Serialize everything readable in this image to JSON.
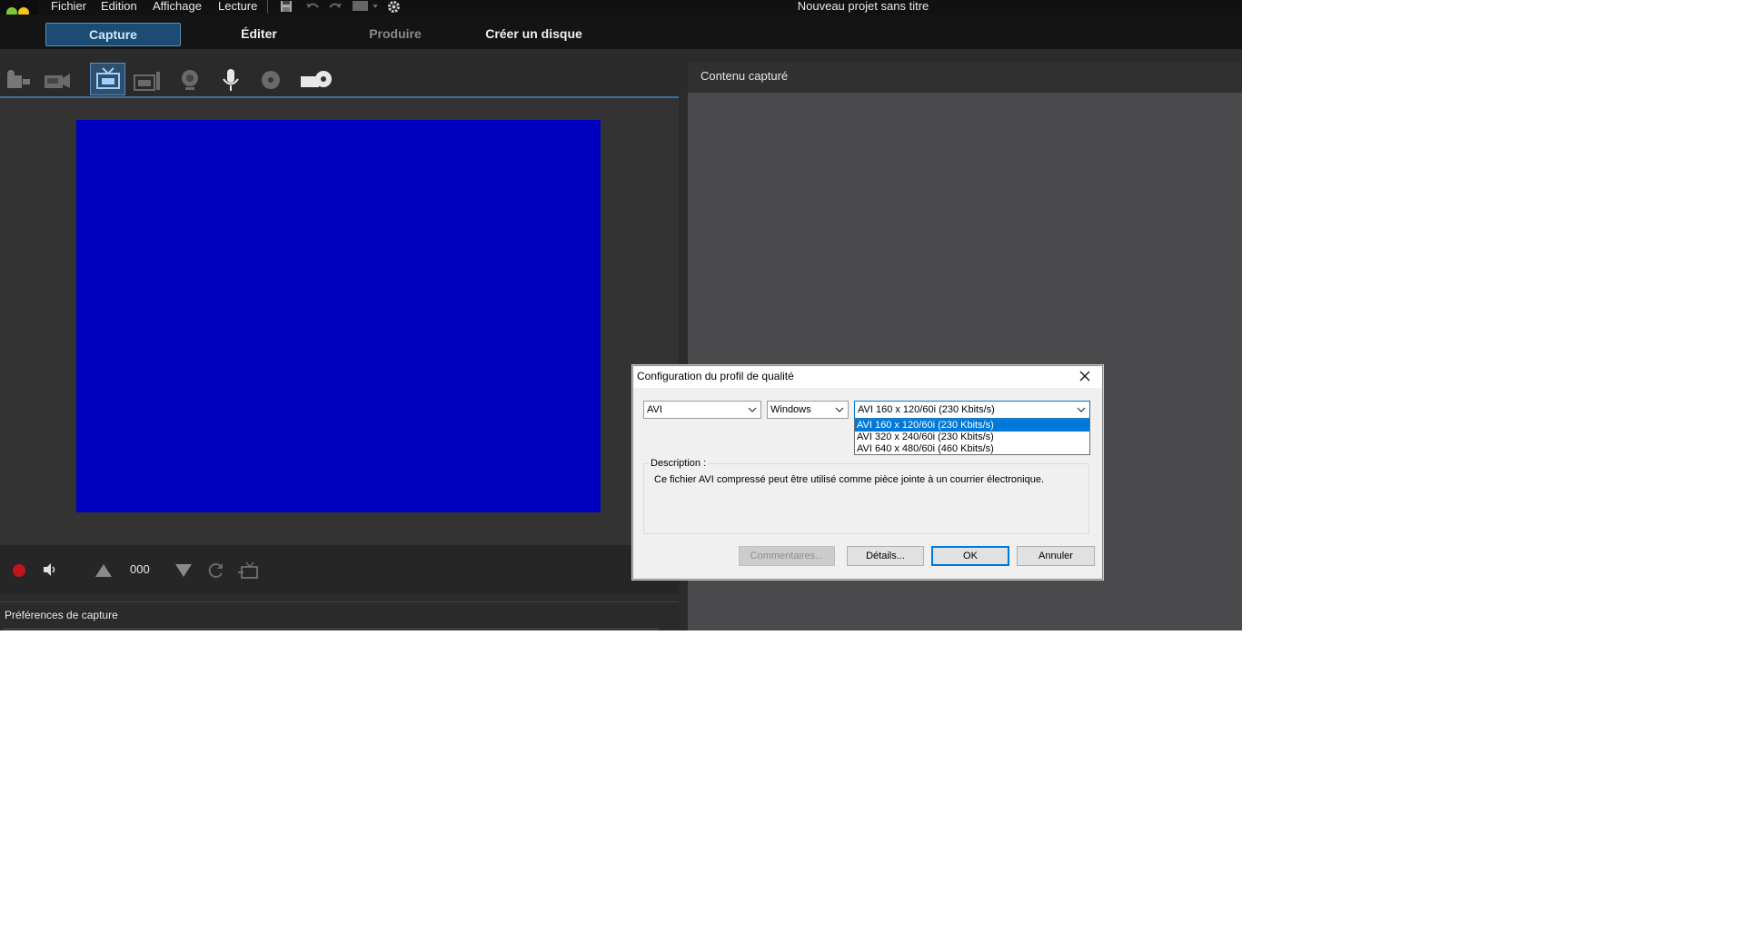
{
  "window": {
    "title": "Nouveau projet sans titre"
  },
  "menu": [
    "Fichier",
    "Edition",
    "Affichage",
    "Lecture"
  ],
  "toolbar_icons": [
    "save-icon",
    "undo-icon",
    "redo-icon",
    "layout-icon",
    "settings-icon"
  ],
  "modes": [
    "Capture",
    "Éditer",
    "Produire",
    "Créer un disque"
  ],
  "capture_sources": [
    "camcorder-dv-icon",
    "hdv-camcorder-icon",
    "tv-capture-icon",
    "digital-tv-icon",
    "webcam-icon",
    "microphone-icon",
    "cd-icon",
    "dvd-icon"
  ],
  "transport": {
    "counter": "000"
  },
  "panels": {
    "captured_content": "Contenu capturé",
    "capture_preferences": "Préférences de capture"
  },
  "dialog": {
    "title": "Configuration du profil de qualité",
    "format": "AVI",
    "codec": "Windows",
    "profile": "AVI 160 x 120/60i (230 Kbits/s)",
    "profile_options": [
      "AVI 160 x 120/60i (230 Kbits/s)",
      "AVI 320 x 240/60i (230 Kbits/s)",
      "AVI 640 x 480/60i (460 Kbits/s)"
    ],
    "description_label": "Description :",
    "description": "Ce fichier AVI compressé peut être utilisé comme pièce jointe à un courrier électronique.",
    "buttons": {
      "comments": "Commentaires...",
      "details": "Détails...",
      "ok": "OK",
      "cancel": "Annuler"
    }
  },
  "colors": {
    "preview": "#0000c0",
    "accent": "#3d6e96",
    "dropdown_highlight": "#0078d7",
    "record": "#c0141a"
  }
}
